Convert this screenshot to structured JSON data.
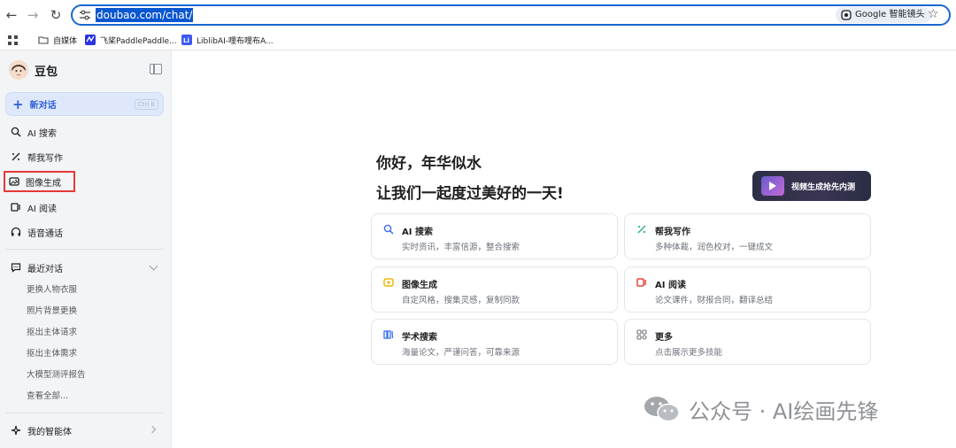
{
  "browser": {
    "url": "doubao.com/chat/",
    "lens_label": "Google 智能镜头",
    "bookmarks": [
      {
        "label": "自媒体",
        "icon": "folder-icon"
      },
      {
        "label": "飞桨PaddlePaddle...",
        "icon": "paddle-favicon"
      },
      {
        "label": "LiblibAI-哩布哩布A...",
        "icon": "liblib-favicon"
      }
    ]
  },
  "sidebar": {
    "brand": "豆包",
    "new_chat": {
      "label": "新对话",
      "shortcut": "Ctrl K"
    },
    "items": [
      {
        "label": "AI 搜索",
        "icon": "ai-search-icon"
      },
      {
        "label": "帮我写作",
        "icon": "writing-icon"
      },
      {
        "label": "图像生成",
        "icon": "image-generate-icon"
      },
      {
        "label": "AI 阅读",
        "icon": "ai-reading-icon"
      },
      {
        "label": "语音通话",
        "icon": "headphones-icon"
      }
    ],
    "recent": {
      "title": "最近对话",
      "items": [
        "更换人物衣服",
        "照片背景更换",
        "抠出主体请求",
        "抠出主体需求",
        "大模型测评报告",
        "查看全部..."
      ]
    },
    "agents_label": "我的智能体"
  },
  "main": {
    "greeting_line1": "你好，年华似水",
    "greeting_line2": "让我们一起度过美好的一天!",
    "promo_label": "视频生成抢先内测",
    "cards": [
      {
        "title": "AI 搜索",
        "desc": "实时资讯，丰富信源，整合搜索",
        "icon": "ai-search-icon",
        "color": "#3b6ef5"
      },
      {
        "title": "帮我写作",
        "desc": "多种体裁，润色校对，一键成文",
        "icon": "writing-icon",
        "color": "#2fb37a"
      },
      {
        "title": "图像生成",
        "desc": "自定风格，搜集灵感，复制同款",
        "icon": "image-generate-icon",
        "color": "#f2b705"
      },
      {
        "title": "AI 阅读",
        "desc": "论文课件，财报合同，翻译总结",
        "icon": "ai-reading-icon",
        "color": "#e8443a"
      },
      {
        "title": "学术搜索",
        "desc": "海量论文，严谨问答，可靠来源",
        "icon": "academic-search-icon",
        "color": "#3b6ef5"
      },
      {
        "title": "更多",
        "desc": "点击展示更多技能",
        "icon": "more-grid-icon",
        "color": "#6b7078"
      }
    ]
  },
  "watermark": {
    "text": "公众号 · AI绘画先锋"
  },
  "colors": {
    "highlight_border": "#e53935",
    "accent": "#2f5fd8"
  }
}
